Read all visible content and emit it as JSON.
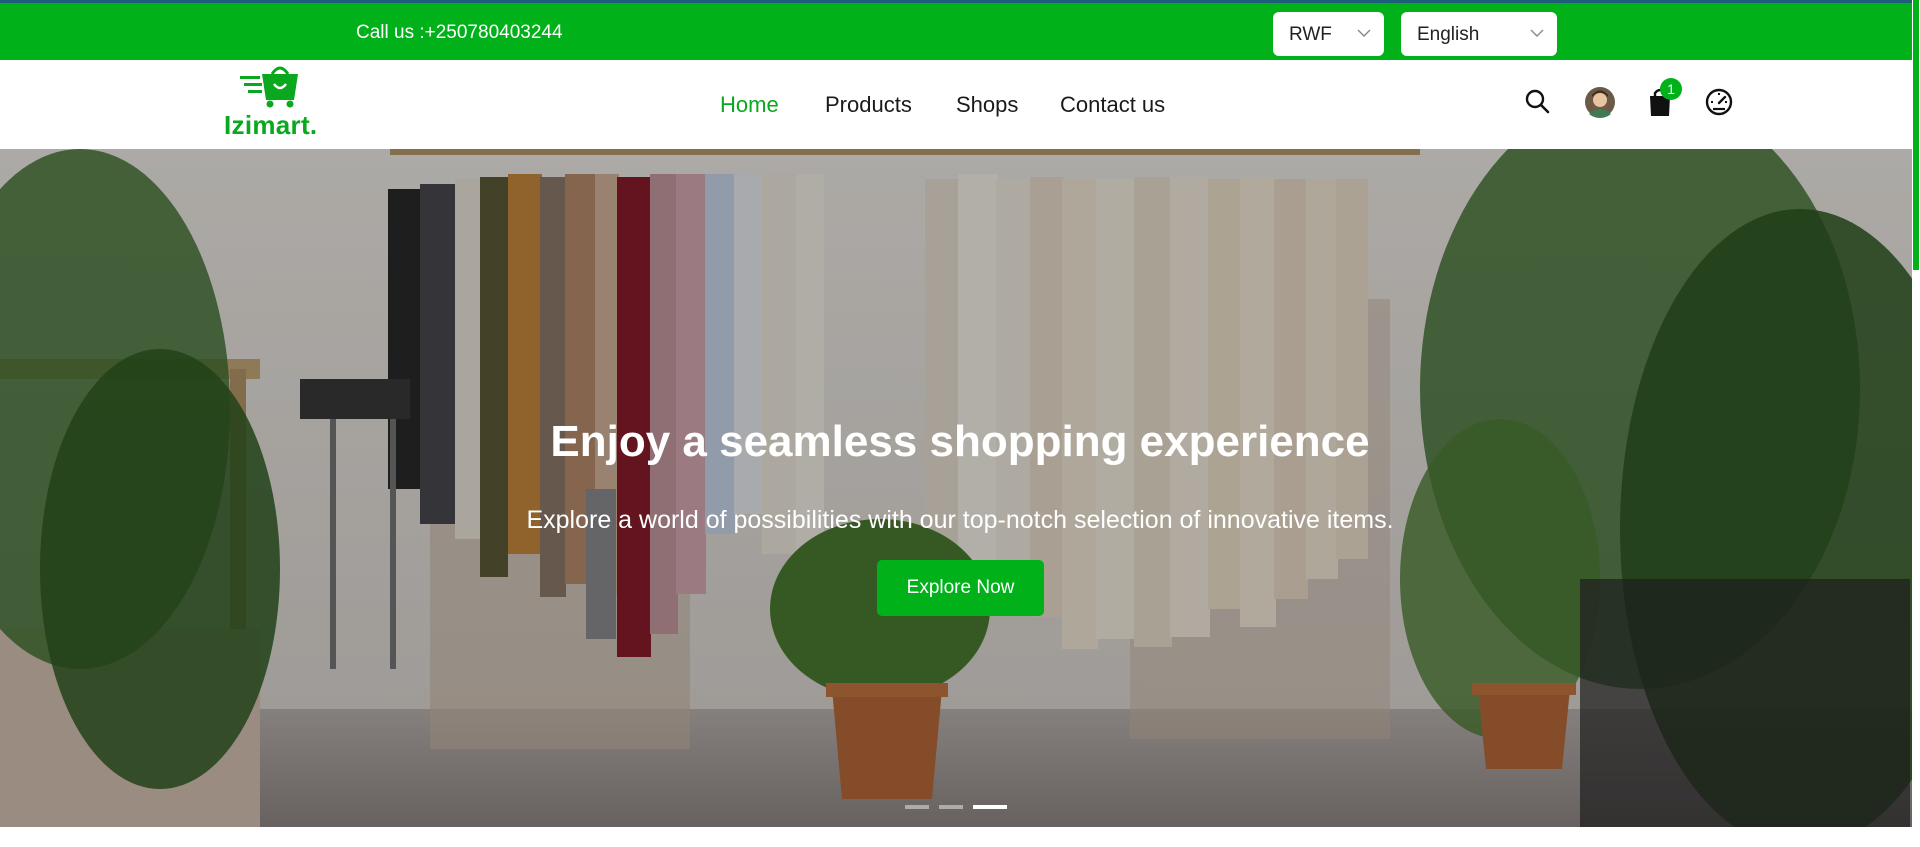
{
  "topbar": {
    "phone": "Call us :+250780403244",
    "currency": "RWF",
    "language": "English"
  },
  "logo": {
    "wordmark": "Izimart."
  },
  "nav": {
    "links": [
      {
        "label": "Home",
        "active": true
      },
      {
        "label": "Products",
        "active": false
      },
      {
        "label": "Shops",
        "active": false
      },
      {
        "label": "Contact us",
        "active": false
      }
    ],
    "icons": [
      "search-icon",
      "avatar",
      "cart-icon",
      "dashboard-gauge-icon"
    ],
    "cart_count": "1"
  },
  "hero": {
    "title": "Enjoy a seamless shopping experience",
    "subtitle": "Explore a world of possibilities with our top-notch selection of innovative items.",
    "cta": "Explore Now",
    "slides_total": 3,
    "active_slide": 3
  },
  "colors": {
    "brand_green": "#00b11a",
    "active_link": "#0aa81e",
    "top_border": "#1f5f7a"
  }
}
